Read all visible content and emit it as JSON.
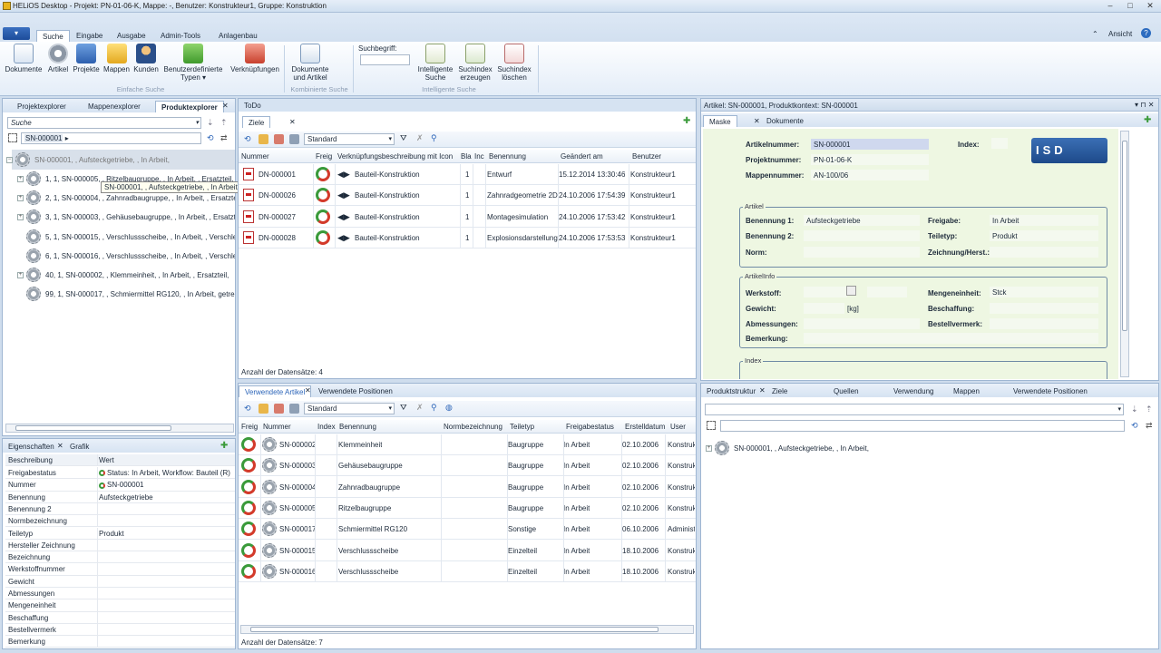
{
  "window": {
    "title": "HELiOS Desktop - Projekt: PN-01-06-K, Mappe: -, Benutzer: Konstrukteur1, Gruppe: Konstruktion"
  },
  "ribbon": {
    "tabs": [
      "Suche",
      "Eingabe",
      "Ausgabe",
      "Admin-Tools",
      "Anlagenbau"
    ],
    "view_label": "Ansicht",
    "buttons": {
      "dokumente": "Dokumente",
      "artikel": "Artikel",
      "projekte": "Projekte",
      "mappen": "Mappen",
      "kunden": "Kunden",
      "benutzer1": "Benutzerdefinierte",
      "benutzer2": "Typen",
      "verknuepfungen": "Verknüpfungen",
      "dokart1": "Dokumente",
      "dokart2": "und Artikel",
      "suchbegriff": "Suchbegriff:",
      "intel1": "Intelligente",
      "intel2": "Suche",
      "idxerz1": "Suchindex",
      "idxerz2": "erzeugen",
      "idxdel1": "Suchindex",
      "idxdel2": "löschen"
    },
    "groups": {
      "einfache": "Einfache Suche",
      "kombinierte": "Kombinierte Suche",
      "intelligente": "Intelligente Suche"
    }
  },
  "left": {
    "tabs": [
      "Projektexplorer",
      "Mappenexplorer",
      "Produktexplorer"
    ],
    "search_placeholder": "Suche",
    "search_value": "SN-000001",
    "tree": [
      "SN-000001, , Aufsteckgetriebe, , In Arbeit,",
      "1, 1, SN-000005, , Ritzelbaugruppe, , In Arbeit, , Ersatzteil,",
      "2, 1, SN-000004, , Zahnradbaugruppe, , In Arbeit, , Ersatzte",
      "3, 1, SN-000003, , Gehäusebaugruppe, , In Arbeit, , Ersatzte",
      "5, 1, SN-000015, , Verschlussscheibe, , In Arbeit, , Verschlei",
      "6, 1, SN-000016, , Verschlussscheibe, , In Arbeit, , Verschlei",
      "40, 1, SN-000002, , Klemmeinheit, , In Arbeit, , Ersatzteil,",
      "99, 1, SN-000017, , Schmiermittel RG120, , In Arbeit, getren"
    ],
    "tooltip": "SN-000001, , Aufsteckgetriebe, , In Arbeit,"
  },
  "props": {
    "tabs": [
      "Eigenschaften",
      "Grafik"
    ],
    "headers": [
      "Beschreibung",
      "Wert"
    ],
    "rows": [
      {
        "k": "Freigabestatus",
        "v": "Status: In Arbeit, Workflow: Bauteil (R)"
      },
      {
        "k": "Nummer",
        "v": "SN-000001"
      },
      {
        "k": "Benennung",
        "v": "Aufsteckgetriebe"
      },
      {
        "k": "Benennung 2",
        "v": ""
      },
      {
        "k": "Normbezeichnung",
        "v": ""
      },
      {
        "k": "Teiletyp",
        "v": "Produkt"
      },
      {
        "k": "Hersteller Zeichnung",
        "v": ""
      },
      {
        "k": "Bezeichnung",
        "v": ""
      },
      {
        "k": "Werkstoffnummer",
        "v": ""
      },
      {
        "k": "Gewicht",
        "v": ""
      },
      {
        "k": "Abmessungen",
        "v": ""
      },
      {
        "k": "Mengeneinheit",
        "v": ""
      },
      {
        "k": "Beschaffung",
        "v": ""
      },
      {
        "k": "Bestellvermerk",
        "v": ""
      },
      {
        "k": "Bemerkung",
        "v": ""
      }
    ]
  },
  "center": {
    "tabs": [
      "ToDo",
      "Ziele"
    ],
    "view_select": "Standard",
    "headers": [
      "Nummer",
      "Freig",
      "Verknüpfungsbeschreibung mit Icon",
      "Bla",
      "Inc",
      "Benennung",
      "Geändert am",
      "Benutzer"
    ],
    "rows": [
      {
        "nummer": "DN-000001",
        "verk": "Bauteil-Konstruktion",
        "bla": "1",
        "ben": "Entwurf",
        "date": "15.12.2014 13:30:46",
        "user": "Konstrukteur1"
      },
      {
        "nummer": "DN-000026",
        "verk": "Bauteil-Konstruktion",
        "bla": "1",
        "ben": "Zahnradgeometrie 2D",
        "date": "24.10.2006 17:54:39",
        "user": "Konstrukteur1"
      },
      {
        "nummer": "DN-000027",
        "verk": "Bauteil-Konstruktion",
        "bla": "1",
        "ben": "Montagesimulation",
        "date": "24.10.2006 17:53:42",
        "user": "Konstrukteur1"
      },
      {
        "nummer": "DN-000028",
        "verk": "Bauteil-Konstruktion",
        "bla": "1",
        "ben": "Explosionsdarstellung",
        "date": "24.10.2006 17:53:53",
        "user": "Konstrukteur1"
      }
    ],
    "count": "Anzahl der Datensätze: 4"
  },
  "used": {
    "tabs": [
      "Verwendete Artikel",
      "Verwendete Positionen"
    ],
    "view_select": "Standard",
    "headers": [
      "Freig",
      "Nummer",
      "Index",
      "Benennung",
      "Normbezeichnung",
      "Teiletyp",
      "Freigabestatus",
      "Erstelldatum",
      "User"
    ],
    "rows": [
      {
        "nr": "SN-000002",
        "ben": "Klemmeinheit",
        "typ": "Baugruppe",
        "status": "In Arbeit",
        "date": "02.10.2006",
        "user": "Konstruk"
      },
      {
        "nr": "SN-000003",
        "ben": "Gehäusebaugruppe",
        "typ": "Baugruppe",
        "status": "In Arbeit",
        "date": "02.10.2006",
        "user": "Konstruk"
      },
      {
        "nr": "SN-000004",
        "ben": "Zahnradbaugruppe",
        "typ": "Baugruppe",
        "status": "In Arbeit",
        "date": "02.10.2006",
        "user": "Konstruk"
      },
      {
        "nr": "SN-000005",
        "ben": "Ritzelbaugruppe",
        "typ": "Baugruppe",
        "status": "In Arbeit",
        "date": "02.10.2006",
        "user": "Konstruk"
      },
      {
        "nr": "SN-000017",
        "ben": "Schmiermittel RG120",
        "typ": "Sonstige",
        "status": "In Arbeit",
        "date": "06.10.2006",
        "user": "Administ"
      },
      {
        "nr": "SN-000015",
        "ben": "Verschlussscheibe",
        "typ": "Einzelteil",
        "status": "In Arbeit",
        "date": "18.10.2006",
        "user": "Konstruk"
      },
      {
        "nr": "SN-000016",
        "ben": "Verschlussscheibe",
        "typ": "Einzelteil",
        "status": "In Arbeit",
        "date": "18.10.2006",
        "user": "Konstruk"
      }
    ],
    "count": "Anzahl der Datensätze: 7"
  },
  "right": {
    "title": "Artikel: SN-000001, Produktkontext: SN-000001",
    "tabs": [
      "Maske",
      "Dokumente"
    ],
    "logo": "ISD",
    "form": {
      "artikelnummer_l": "Artikelnummer:",
      "artikelnummer": "SN-000001",
      "index_l": "Index:",
      "projektnummer_l": "Projektnummer:",
      "projektnummer": "PN-01-06-K",
      "mappennummer_l": "Mappennummer:",
      "mappennummer": "AN-100/06",
      "artikel_legend": "Artikel",
      "benennung1_l": "Benennung 1:",
      "benennung1": "Aufsteckgetriebe",
      "freigabe_l": "Freigabe:",
      "freigabe": "In Arbeit",
      "benennung2_l": "Benennung 2:",
      "teiletyp_l": "Teiletyp:",
      "teiletyp": "Produkt",
      "norm_l": "Norm:",
      "zeichnung_l": "Zeichnung/Herst.:",
      "info_legend": "ArtikelInfo",
      "werkstoff_l": "Werkstoff:",
      "mengeneinheit_l": "Mengeneinheit:",
      "mengeneinheit": "Stck",
      "gewicht_l": "Gewicht:",
      "gewicht_unit": "[kg]",
      "beschaffung_l": "Beschaffung:",
      "abmessungen_l": "Abmessungen:",
      "bestellvermerk_l": "Bestellvermerk:",
      "bemerkung_l": "Bemerkung:",
      "index_legend": "Index"
    },
    "bottom_tabs": [
      "Produktstruktur",
      "Ziele",
      "Quellen",
      "Verwendung",
      "Mappen",
      "Verwendete Positionen"
    ],
    "bottom_tree": "SN-000001, , Aufsteckgetriebe, , In Arbeit,"
  }
}
